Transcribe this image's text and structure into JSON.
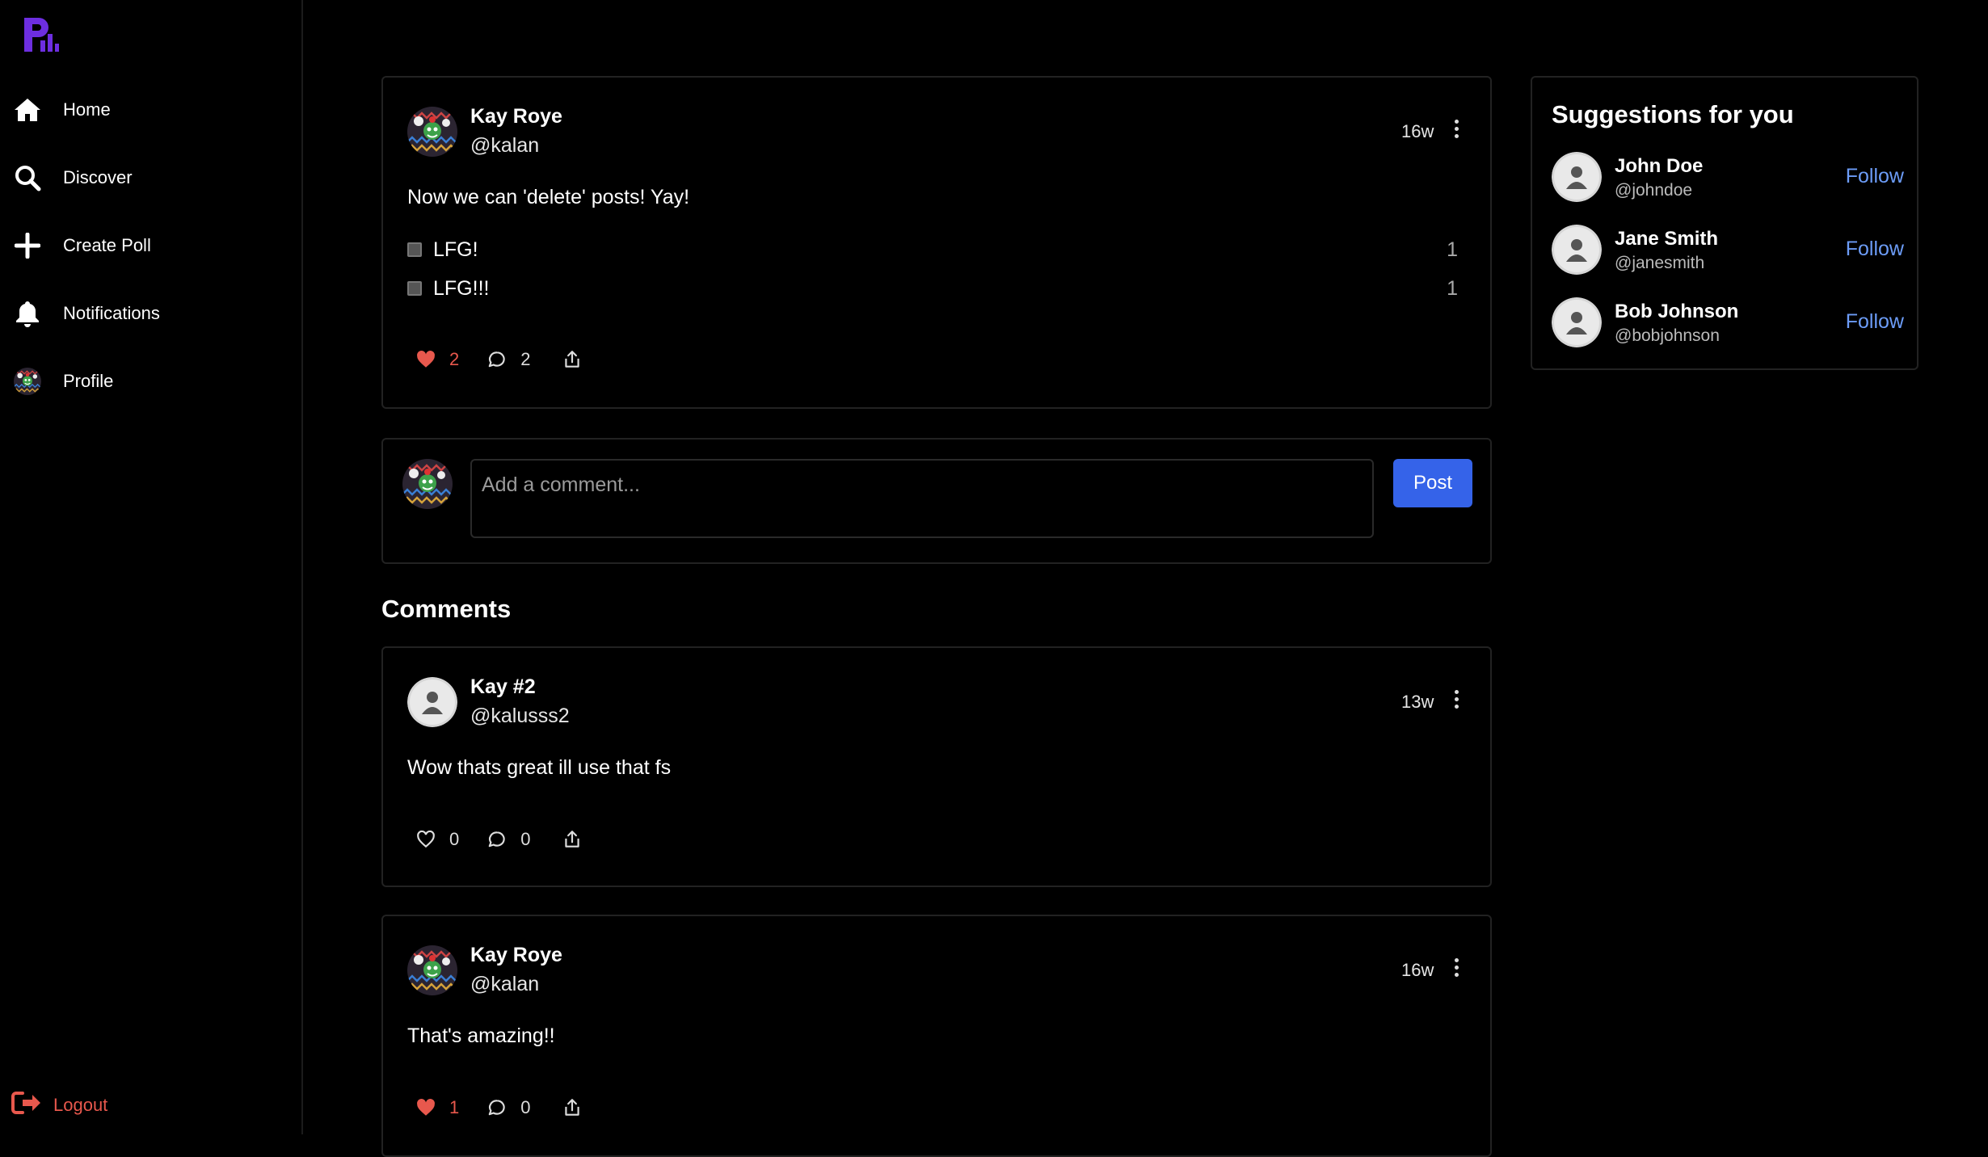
{
  "sidebar": {
    "items": [
      {
        "label": "Home",
        "icon": "home-icon"
      },
      {
        "label": "Discover",
        "icon": "search-icon"
      },
      {
        "label": "Create Poll",
        "icon": "plus-icon"
      },
      {
        "label": "Notifications",
        "icon": "bell-icon"
      },
      {
        "label": "Profile",
        "icon": "avatar"
      }
    ],
    "logout_label": "Logout"
  },
  "post": {
    "author_name": "Kay Roye",
    "author_handle": "@kalan",
    "time": "16w",
    "text": "Now we can 'delete' posts! Yay!",
    "options": [
      {
        "label": "LFG!",
        "count": "1"
      },
      {
        "label": "LFG!!!",
        "count": "1"
      }
    ],
    "likes": "2",
    "comments": "2"
  },
  "composer": {
    "placeholder": "Add a comment...",
    "post_label": "Post"
  },
  "comments_title": "Comments",
  "comments": [
    {
      "author_name": "Kay #2",
      "author_handle": "@kalusss2",
      "time": "13w",
      "text": "Wow thats great ill use that fs",
      "likes": "0",
      "comments": "0",
      "liked": false
    },
    {
      "author_name": "Kay Roye",
      "author_handle": "@kalan",
      "time": "16w",
      "text": "That's amazing!!",
      "likes": "1",
      "comments": "0",
      "liked": true
    }
  ],
  "suggestions": {
    "title": "Suggestions for you",
    "follow_label": "Follow",
    "users": [
      {
        "name": "John Doe",
        "handle": "@johndoe"
      },
      {
        "name": "Jane Smith",
        "handle": "@janesmith"
      },
      {
        "name": "Bob Johnson",
        "handle": "@bobjohnson"
      }
    ]
  },
  "colors": {
    "accent": "#3563e9",
    "like": "#e8584d",
    "link": "#6c9cf7",
    "brand": "#6d2ee0"
  }
}
